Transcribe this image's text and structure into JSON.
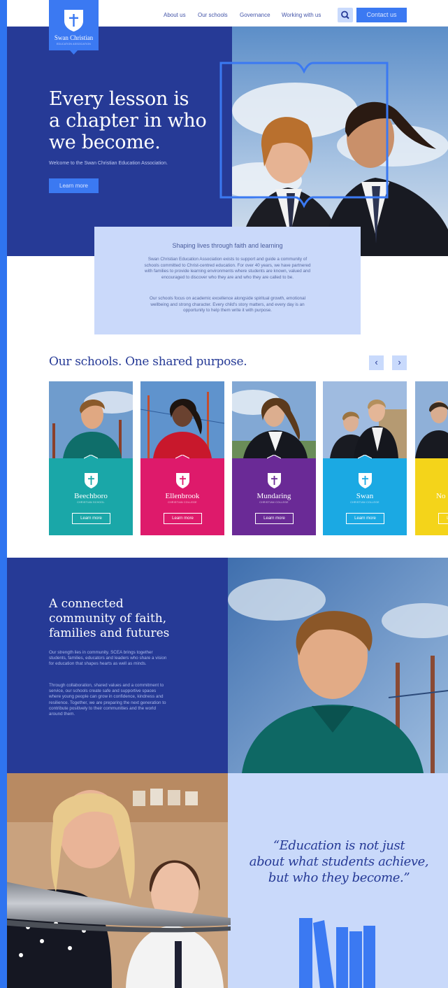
{
  "header": {
    "logo_name": "Swan Christian",
    "logo_sub": "EDUCATION ASSOCIATION",
    "nav": [
      "About us",
      "Our schools",
      "Governance",
      "Working with us"
    ],
    "contact": "Contact us",
    "search_icon": "search-icon"
  },
  "hero": {
    "title_lines": [
      "Every lesson is",
      "a chapter in who",
      "we become."
    ],
    "subtitle": "Welcome to the Swan Christian Education Association.",
    "button": "Learn more"
  },
  "intro": {
    "title": "Shaping lives through faith and learning",
    "p1": "Swan Christian Education Association exists to support and guide a community of schools committed to Christ-centred education. For over 40 years, we have partnered with families to provide learning environments where students are known, valued and encouraged to discover who they are and who they are called to be.",
    "p2": "Our schools focus on academic excellence alongside spiritual growth, emotional wellbeing and strong character. Every child's story matters, and every day is an opportunity to help them write it with purpose."
  },
  "schools": {
    "title": "Our schools. One shared purpose.",
    "prev": "‹",
    "next": "›",
    "cards": [
      {
        "name": "Beechboro",
        "sub": "CHRISTIAN SCHOOL",
        "button": "Learn more",
        "color": "#1aa7a8"
      },
      {
        "name": "Ellenbrook",
        "sub": "CHRISTIAN COLLEGE",
        "button": "Learn more",
        "color": "#de1a6b"
      },
      {
        "name": "Mundaring",
        "sub": "CHRISTIAN COLLEGE",
        "button": "Learn more",
        "color": "#6a2a96"
      },
      {
        "name": "Swan",
        "sub": "CHRISTIAN COLLEGE",
        "button": "Learn more",
        "color": "#1ba9e3"
      },
      {
        "name": "No",
        "sub": "",
        "button": "Learn more",
        "color": "#f4d41a"
      }
    ]
  },
  "community": {
    "title_lines": [
      "A connected",
      "community of faith,",
      "families and futures"
    ],
    "p1": "Our strength lies in community. SCEA brings together students, families, educators and leaders who share a vision for education that shapes hearts as well as minds.",
    "p2": "Through collaboration, shared values and a commitment to service, our schools create safe and supportive spaces where young people can grow in confidence, kindness and resilience. Together, we are preparing the next generation to contribute positively to their communities and the world around them."
  },
  "quote": {
    "lines": [
      "“Education is not just",
      "about what students achieve,",
      "but who they become.”"
    ]
  },
  "colors": {
    "navy": "#263a96",
    "accent": "#3b79f2",
    "light": "#c9d9fa"
  }
}
